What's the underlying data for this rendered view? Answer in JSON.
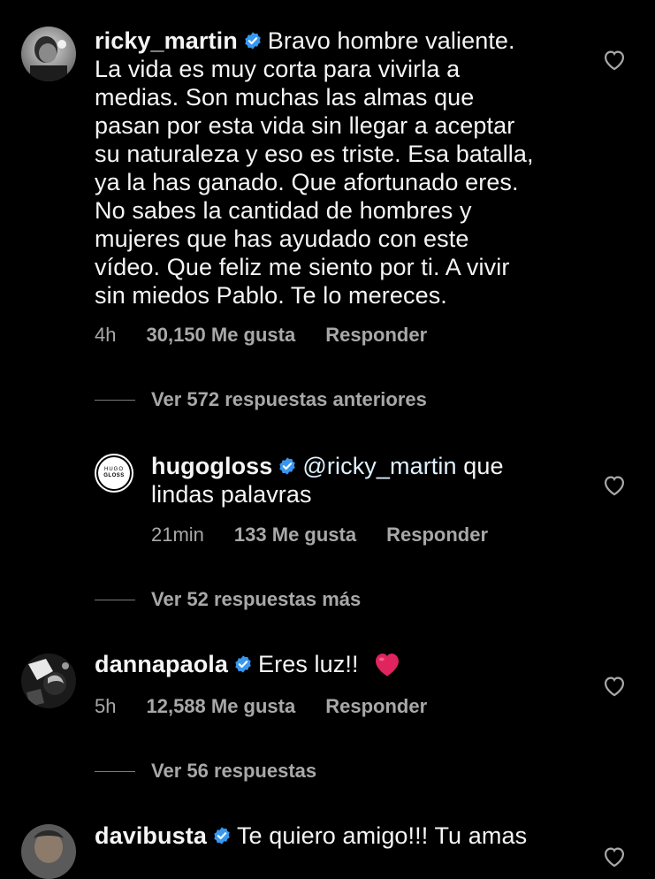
{
  "colors": {
    "background": "#000000",
    "text": "#f5f5f5",
    "secondary": "#a8a8a8",
    "verified": "#3897f0",
    "heart_emoji": "#e0245e"
  },
  "comments": [
    {
      "username": "ricky_martin",
      "verified": true,
      "text": "Bravo hombre valiente. La vida es muy corta para vivirla a medias. Son muchas las almas que pasan por esta vida sin llegar a aceptar su naturaleza y eso es triste. Esa batalla, ya la has ganado. Que afortunado eres. No sabes la cantidad de hombres y mujeres que has ayudado con este vídeo. Que feliz me siento por ti. A vivir sin miedos Pablo. Te lo mereces.",
      "lines": [
        "La vida es muy corta para vivirla a",
        "medias. Son muchas las almas que",
        "pasan por esta vida sin llegar a aceptar",
        "su naturaleza y eso es triste. Esa batalla,",
        "ya la has ganado. Que afortunado eres.",
        "No sabes la cantidad de hombres y",
        "mujeres que has ayudado con este",
        "vídeo. Que feliz me siento por ti. A vivir",
        "sin miedos Pablo. Te lo mereces."
      ],
      "first_line": "Bravo hombre valiente.",
      "time": "4h",
      "likes": "30,150 Me gusta",
      "reply_label": "Responder",
      "view_replies": "Ver 572 respuestas anteriores"
    },
    {
      "username": "hugogloss",
      "verified": true,
      "avatar_text_top": "HUGO",
      "avatar_text_bottom": "GLOSS",
      "mention": "@ricky_martin",
      "first_line_rest": "que",
      "second_line": "lindas palavras",
      "time": "21min",
      "likes": "133 Me gusta",
      "reply_label": "Responder",
      "view_replies": "Ver 52 respuestas más"
    },
    {
      "username": "dannapaola",
      "verified": true,
      "text": "Eres luz!!",
      "emoji": "❤️",
      "time": "5h",
      "likes": "12,588 Me gusta",
      "reply_label": "Responder",
      "view_replies": "Ver 56 respuestas"
    },
    {
      "username": "davibusta",
      "verified": true,
      "text": "Te quiero amigo!!! Tu amas"
    }
  ]
}
